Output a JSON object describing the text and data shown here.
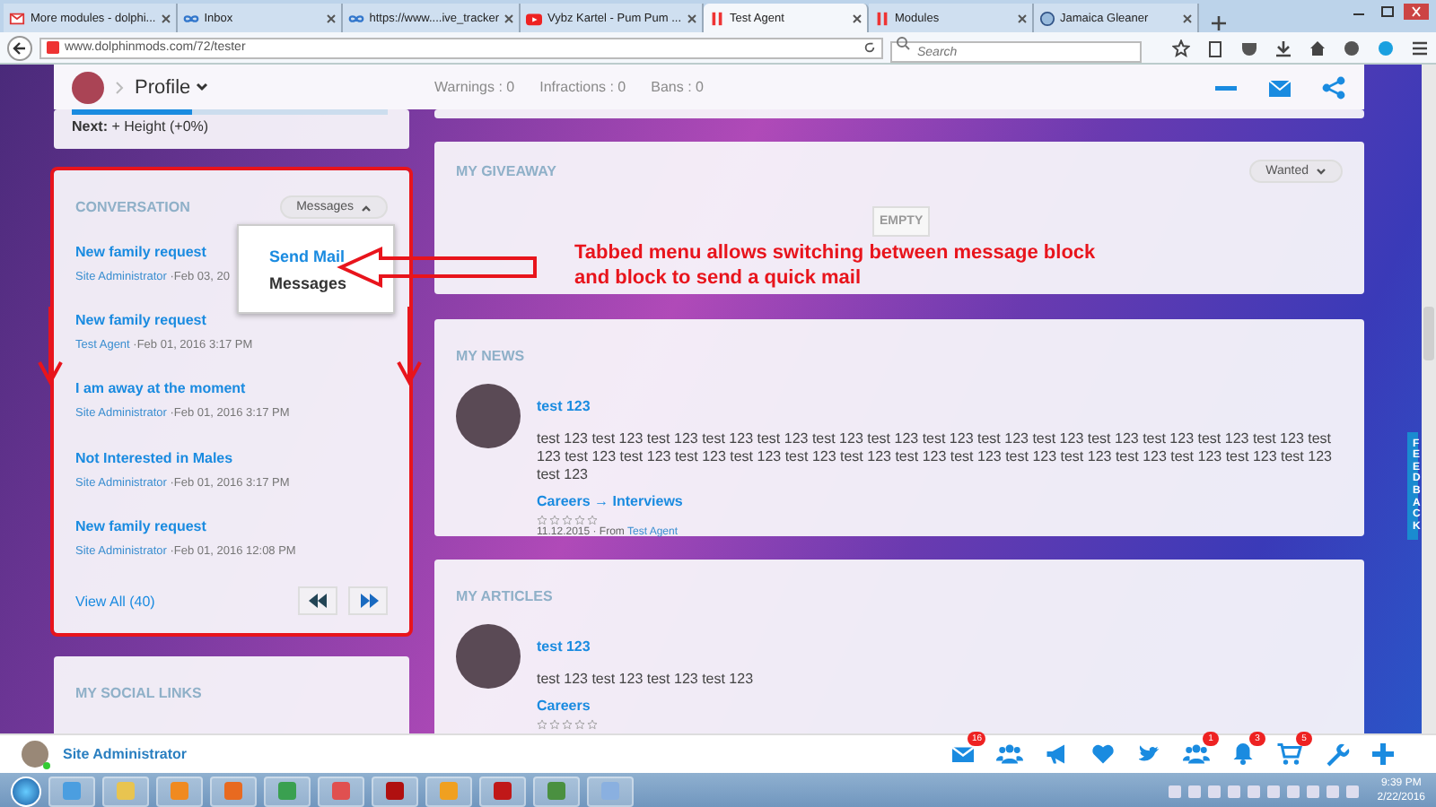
{
  "browser": {
    "tabs": [
      {
        "title": "More modules - dolphi...",
        "kind": "gmail",
        "selected": false
      },
      {
        "title": "Inbox",
        "kind": "infinity",
        "selected": false
      },
      {
        "title": "https://www....ive_tracker",
        "kind": "infinity",
        "selected": false
      },
      {
        "title": "Vybz Kartel - Pum Pum ...",
        "kind": "youtube",
        "selected": false
      },
      {
        "title": "Test Agent",
        "kind": "dolphin",
        "selected": true
      },
      {
        "title": "Modules",
        "kind": "dolphin",
        "selected": false
      },
      {
        "title": "Jamaica Gleaner",
        "kind": "globe",
        "selected": false
      }
    ],
    "url": "www.dolphinmods.com/72/tester",
    "search": {
      "placeholder": "Search"
    }
  },
  "header": {
    "profile": "Profile",
    "stats": [
      "Warnings : 0",
      "Infractions : 0",
      "Bans : 0"
    ]
  },
  "level_card": {
    "level": 0.38,
    "next": "**Next:** + Height (+0%)"
  },
  "conversation": {
    "title": "CONVERSATION",
    "dropdown": "Messages",
    "menu": [
      {
        "label": "Send Mail",
        "selected": true
      },
      {
        "label": "Messages",
        "selected": false
      }
    ],
    "messages": [
      {
        "subject": "New family request",
        "author": "Site Administrator",
        "date": "·Feb 03, 20"
      },
      {
        "subject": "New family request",
        "author": "Test Agent",
        "date": "·Feb 01, 2016 3:17 PM"
      },
      {
        "subject": "I am away at the moment",
        "author": "Site Administrator",
        "date": "·Feb 01, 2016 3:17 PM"
      },
      {
        "subject": "Not Interested in Males",
        "author": "Site Administrator",
        "date": "·Feb 01, 2016 3:17 PM"
      },
      {
        "subject": "New family request",
        "author": "Site Administrator",
        "date": "·Feb 01, 2016 12:08 PM"
      }
    ],
    "view_all": "View All (40)"
  },
  "social": {
    "title": "MY SOCIAL LINKS"
  },
  "giveaway": {
    "title": "MY GIVEAWAY",
    "filter": "Wanted",
    "empty": "EMPTY"
  },
  "news": {
    "title": "MY NEWS",
    "item": {
      "title": "test 123",
      "body": "test 123 test 123 test 123 test 123 test 123 test 123 test 123 test 123 test 123 test 123 test 123 test 123 test 123 test 123 test 123 test 123 test 123 test 123 test 123 test 123 test 123 test 123 test 123 test 123 test 123 test 123 test 123 test 123 test 123 test 123",
      "category": "Careers → Interviews",
      "stars": 0,
      "date": "11.12.2015",
      "from": "· From",
      "author": "Test Agent"
    }
  },
  "articles": {
    "title": "MY ARTICLES",
    "item": {
      "title": "test 123",
      "body": "test 123 test 123 test 123 test 123",
      "category": "Careers",
      "stars": 0
    }
  },
  "feedback": "FEEDBACK",
  "annotation": {
    "text": "Tabbed menu allows switching between message block and block to send a quick mail"
  },
  "bottom_bar": {
    "user": "Site Administrator",
    "icons": [
      {
        "kind": "mail",
        "badge": "16"
      },
      {
        "kind": "users"
      },
      {
        "kind": "megaphone"
      },
      {
        "kind": "heart"
      },
      {
        "kind": "bird"
      },
      {
        "kind": "users",
        "badge": "1"
      },
      {
        "kind": "bell",
        "badge": "3"
      },
      {
        "kind": "cart",
        "badge": "5"
      },
      {
        "kind": "wrench"
      },
      {
        "kind": "plus"
      }
    ]
  },
  "taskbar": {
    "time": "9:39 PM",
    "date": "2/22/2016"
  }
}
